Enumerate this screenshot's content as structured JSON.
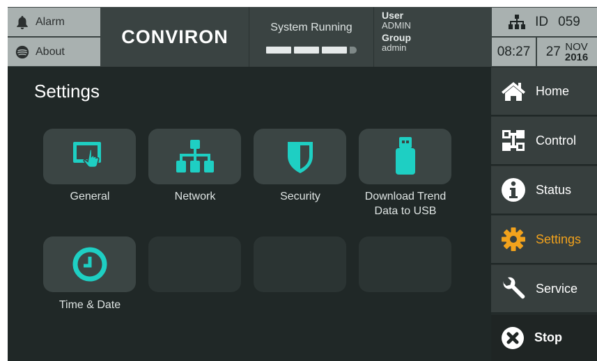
{
  "header": {
    "alarm_label": "Alarm",
    "about_label": "About",
    "logo_text": "CONVIRON",
    "status_text": "System Running",
    "user_label": "User",
    "user_value": "ADMIN",
    "group_label": "Group",
    "group_value": "admin",
    "id_label": "ID",
    "id_value": "059",
    "time": "08:27",
    "date_day": "27",
    "date_month": "NOV",
    "date_year": "2016"
  },
  "page": {
    "title": "Settings"
  },
  "tiles": [
    {
      "label": "General",
      "icon": "touch-screen-icon"
    },
    {
      "label": "Network",
      "icon": "network-icon"
    },
    {
      "label": "Security",
      "icon": "shield-icon"
    },
    {
      "label_line1": "Download Trend",
      "label_line2": "Data to USB",
      "icon": "usb-drive-icon"
    },
    {
      "label": "Time & Date",
      "icon": "clock-icon"
    }
  ],
  "nav": [
    {
      "label": "Home",
      "icon": "home-icon"
    },
    {
      "label": "Control",
      "icon": "control-icon"
    },
    {
      "label": "Status",
      "icon": "info-icon"
    },
    {
      "label": "Settings",
      "icon": "gear-icon",
      "active": true
    },
    {
      "label": "Service",
      "icon": "wrench-icon"
    },
    {
      "label": "Stop",
      "icon": "stop-icon"
    }
  ],
  "colors": {
    "accent": "#1ecfc3",
    "active_nav": "#f2a21c",
    "background": "#202827",
    "header": "#3a4342",
    "header_button": "#a9b1b0"
  }
}
